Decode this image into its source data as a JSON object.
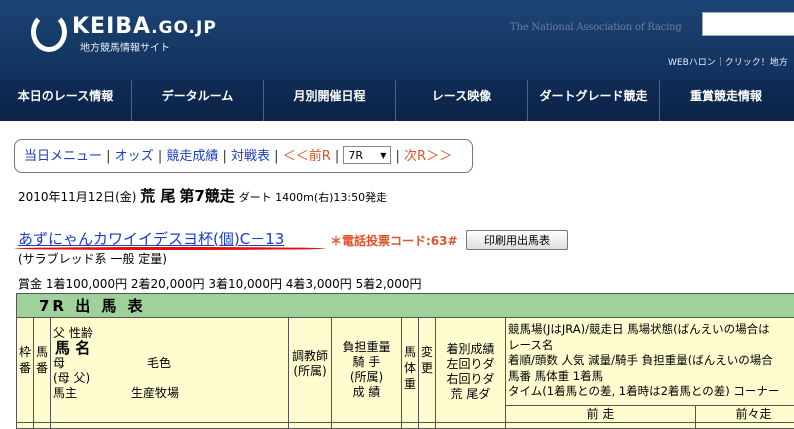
{
  "header": {
    "logo_text": "KEIBA",
    "logo_suffix": ".GO.JP",
    "logo_subtitle": "地方競馬情報サイト",
    "association": "The National Association of Racing",
    "top_links": "WEBハロン｜クリック！地方"
  },
  "nav": {
    "items": [
      "本日のレース情報",
      "データルーム",
      "月別開催日程",
      "レース映像",
      "ダートグレード競走",
      "重賞競走情報"
    ]
  },
  "submenu": {
    "today_menu": "当日メニュー",
    "odds": "オッズ",
    "results": "競走成績",
    "matchups": "対戦表",
    "prev": "＜＜前R",
    "race_select": "7R",
    "next": "次R＞＞"
  },
  "race": {
    "date": "2010年11月12日(金)",
    "venue": "荒 尾",
    "race_no": "第7競走",
    "course": "ダート 1400m(右)13:50発走",
    "title": "あずにゃんカワイイデスヨ杯(個)C－13",
    "phone_code": "＊電話投票コード:63#",
    "print_label": "印刷用出馬表",
    "breed": "(サラブレッド系 一般 定量)",
    "prize": "賞金 1着100,000円 2着20,000円 3着10,000円 4着3,000円 5着2,000円"
  },
  "table": {
    "title": "7R 出 馬 表",
    "col_waku": "枠番",
    "col_uma": "馬番",
    "col_horse_line1": "父 性齢",
    "col_horse_name": "馬 名",
    "col_horse_mother": "母",
    "col_horse_color": "毛色",
    "col_horse_bms": "(母 父)",
    "col_horse_owner": "馬主",
    "col_horse_breeder": "生産牧場",
    "col_trainer": "調教師(所属)",
    "col_weight": [
      "負担重量",
      "騎 手",
      "(所属)",
      "成 績"
    ],
    "col_body": "馬体重",
    "col_change": "変更",
    "col_record": [
      "着別成績",
      "左回りダ",
      "右回りダ",
      "荒 尾ダ"
    ],
    "col_past": [
      "競馬場(JはJRA)/競走日 馬場状態(ばんえいの場合は",
      "レース名",
      "着順/頭数 人気 減量/騎手 負担重量(ばんえいの場合",
      "馬番 馬体重 1着馬",
      "タイム(1着馬との差, 1着時は2着馬との差) コーナー"
    ],
    "col_prev1": "前 走",
    "col_prev2": "前々走"
  }
}
